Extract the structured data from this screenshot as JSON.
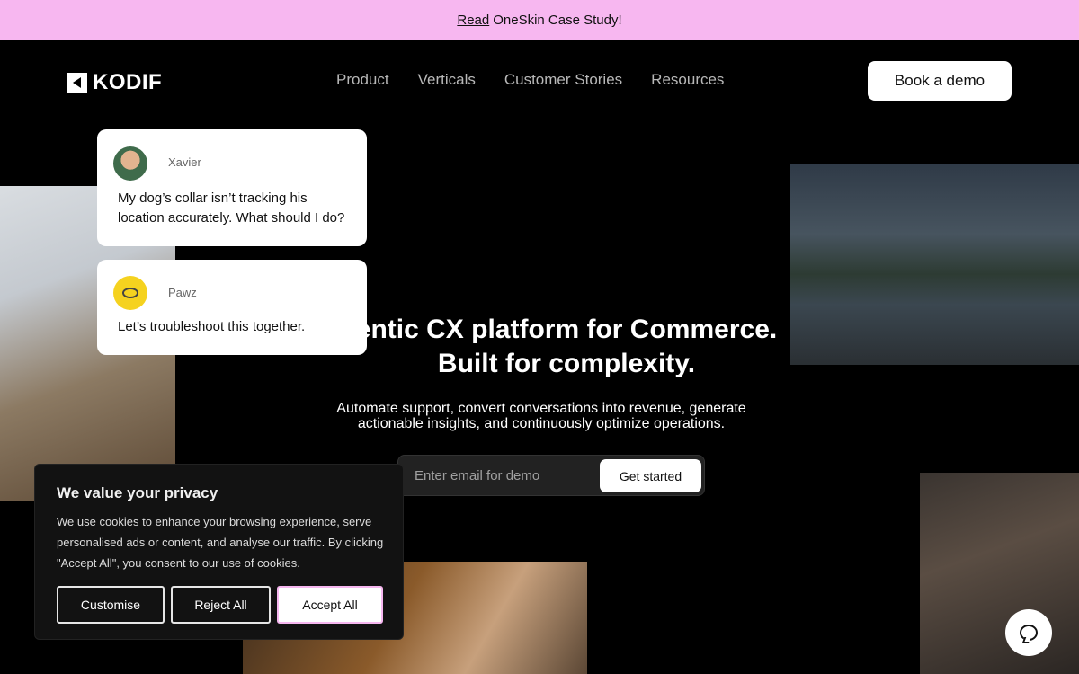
{
  "banner": {
    "link_label": "Read",
    "text": "OneSkin Case Study!"
  },
  "header": {
    "logo_text": "KODIF",
    "nav": [
      "Product",
      "Verticals",
      "Customer Stories",
      "Resources"
    ],
    "demo_label": "Book a demo"
  },
  "chat": [
    {
      "name": "Xavier",
      "message": "My dog’s collar isn’t tracking his location accurately. What should I do?",
      "avatar_icon": "user-avatar"
    },
    {
      "name": "Pawz",
      "message": "Let’s troubleshoot this together.",
      "avatar_icon": "collar-icon",
      "avatar_color": "#f5d21f"
    }
  ],
  "hero": {
    "title_line1": "entic CX platform for Commerce.",
    "title_line2": "Built for complexity.",
    "subtitle": "Automate support, convert conversations into revenue, generate actionable insights, and continuously optimize operations.",
    "email_placeholder": "Enter email for demo",
    "cta_label": "Get started"
  },
  "cookie": {
    "title": "We value your privacy",
    "body": "We use cookies to enhance your browsing experience, serve personalised ads or content, and analyse our traffic. By clicking \"Accept All\", you consent to our use of cookies.",
    "customise_label": "Customise",
    "reject_label": "Reject All",
    "accept_label": "Accept All"
  },
  "colors": {
    "banner_bg": "#f7b7f0",
    "page_bg": "#000000",
    "accent_pink": "#f6b7f0"
  },
  "help_icon": "chat-bubble-icon"
}
